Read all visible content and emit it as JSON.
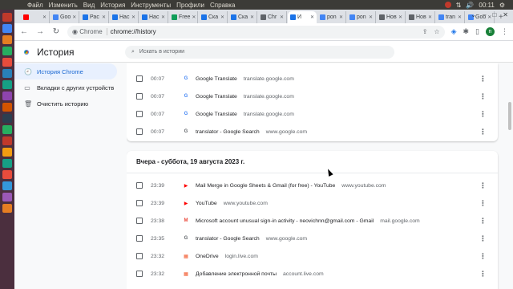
{
  "system": {
    "menu": [
      "Файл",
      "Изменить",
      "Вид",
      "История",
      "Инструменты",
      "Профили",
      "Справка"
    ],
    "clock": "00:11"
  },
  "tabs": [
    {
      "label": "",
      "color": "#ff0000"
    },
    {
      "label": "Goo",
      "color": "#4285f4"
    },
    {
      "label": "Рас",
      "color": "#1a73e8"
    },
    {
      "label": "Нас",
      "color": "#1a73e8"
    },
    {
      "label": "Нас",
      "color": "#1a73e8"
    },
    {
      "label": "Free",
      "color": "#0f9d58"
    },
    {
      "label": "Ска",
      "color": "#1a73e8"
    },
    {
      "label": "Ска",
      "color": "#1a73e8"
    },
    {
      "label": "Chr",
      "color": "#5f6368"
    },
    {
      "label": "И",
      "color": "#1a73e8",
      "active": true
    },
    {
      "label": "pon",
      "color": "#4285f4"
    },
    {
      "label": "pon",
      "color": "#4285f4"
    },
    {
      "label": "Нов",
      "color": "#5f6368"
    },
    {
      "label": "Нов",
      "color": "#5f6368"
    },
    {
      "label": "tran",
      "color": "#4285f4"
    },
    {
      "label": "Goo",
      "color": "#4285f4"
    }
  ],
  "toolbar": {
    "back": "←",
    "forward": "→",
    "reload": "↻",
    "site_label": "Chrome",
    "url": "chrome://history",
    "avatar": "n"
  },
  "page": {
    "title": "История",
    "search_placeholder": "Искать в истории"
  },
  "sidebar": [
    {
      "label": "История Chrome",
      "icon": "history-icon",
      "glyph": "🕘",
      "active": true
    },
    {
      "label": "Вкладки с других устройств",
      "icon": "devices-icon",
      "glyph": "▭",
      "active": false
    },
    {
      "label": "Очистить историю",
      "icon": "trash-icon",
      "glyph": "🗑",
      "active": false
    }
  ],
  "today_rows": [
    {
      "time": "00:07",
      "title": "Google Translate",
      "domain": "translate.google.com",
      "icon": "translate-icon",
      "icon_color": "#4285f4",
      "glyph": "G"
    },
    {
      "time": "00:07",
      "title": "Google Translate",
      "domain": "translate.google.com",
      "icon": "translate-icon",
      "icon_color": "#4285f4",
      "glyph": "G"
    },
    {
      "time": "00:07",
      "title": "Google Translate",
      "domain": "translate.google.com",
      "icon": "translate-icon",
      "icon_color": "#4285f4",
      "glyph": "G"
    },
    {
      "time": "00:07",
      "title": "translator - Google Search",
      "domain": "www.google.com",
      "icon": "google-icon",
      "icon_color": "#5f6368",
      "glyph": "G"
    }
  ],
  "yesterday": {
    "heading": "Вчера - суббота, 19 августа 2023 г.",
    "rows": [
      {
        "time": "23:39",
        "title": "Mail Merge in Google Sheets & Gmail (for free) - YouTube",
        "domain": "www.youtube.com",
        "icon": "youtube-icon",
        "icon_color": "#ff0000",
        "glyph": "▶"
      },
      {
        "time": "23:39",
        "title": "YouTube",
        "domain": "www.youtube.com",
        "icon": "youtube-icon",
        "icon_color": "#ff0000",
        "glyph": "▶"
      },
      {
        "time": "23:38",
        "title": "Microsoft account unusual sign-in activity - neovichnn@gmail.com - Gmail",
        "domain": "mail.google.com",
        "icon": "gmail-icon",
        "icon_color": "#ea4335",
        "glyph": "M"
      },
      {
        "time": "23:35",
        "title": "translator - Google Search",
        "domain": "www.google.com",
        "icon": "google-icon",
        "icon_color": "#5f6368",
        "glyph": "G"
      },
      {
        "time": "23:32",
        "title": "OneDrive",
        "domain": "login.live.com",
        "icon": "microsoft-icon",
        "icon_color": "#f25022",
        "glyph": "▦"
      },
      {
        "time": "23:32",
        "title": "Добавление электронной почты",
        "domain": "account.live.com",
        "icon": "microsoft-icon",
        "icon_color": "#f25022",
        "glyph": "▦"
      }
    ]
  }
}
